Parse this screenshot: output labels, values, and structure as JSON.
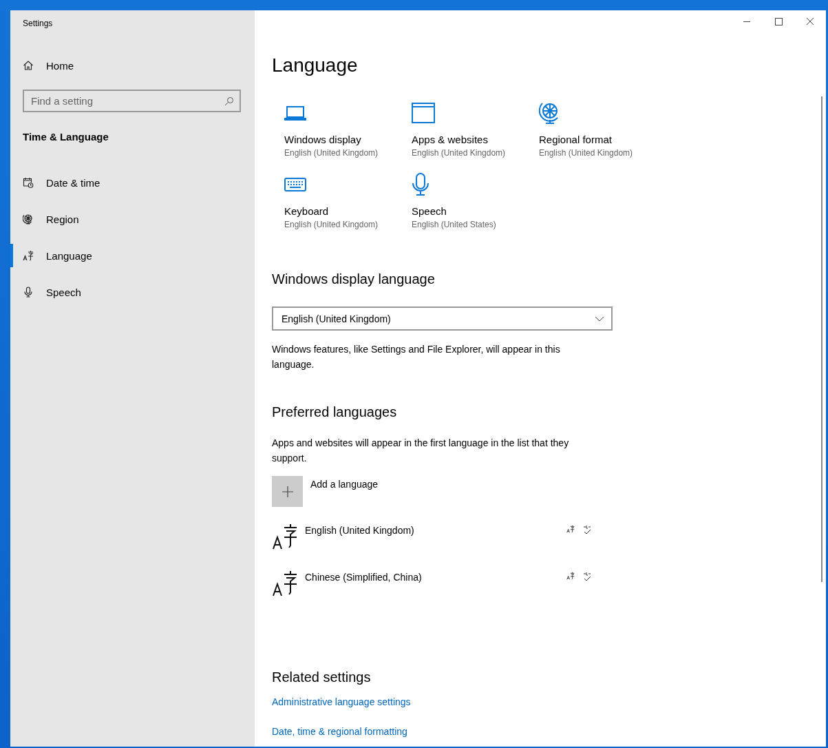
{
  "window": {
    "title": "Settings"
  },
  "sidebar": {
    "home": "Home",
    "search": {
      "placeholder": "Find a setting"
    },
    "section": "Time & Language",
    "items": [
      {
        "kind": "calendar",
        "label": "Date & time",
        "selected": false
      },
      {
        "kind": "globe",
        "label": "Region",
        "selected": false
      },
      {
        "kind": "language",
        "label": "Language",
        "selected": true
      },
      {
        "kind": "microphone",
        "label": "Speech",
        "selected": false
      }
    ]
  },
  "page": {
    "title": "Language",
    "tiles": [
      {
        "kind": "laptop",
        "title": "Windows display",
        "value": "English (United Kingdom)"
      },
      {
        "kind": "window",
        "title": "Apps & websites",
        "value": "English (United Kingdom)"
      },
      {
        "kind": "globe",
        "title": "Regional format",
        "value": "English (United Kingdom)"
      },
      {
        "kind": "keyboard",
        "title": "Keyboard",
        "value": "English (United Kingdom)"
      },
      {
        "kind": "microphone",
        "title": "Speech",
        "value": "English (United States)"
      }
    ],
    "display_language": {
      "heading": "Windows display language",
      "dropdown": "English (United Kingdom)",
      "note": "Windows features, like Settings and File Explorer, will appear in this language."
    },
    "preferred": {
      "heading": "Preferred languages",
      "note": "Apps and websites will appear in the first language in the list that they support.",
      "add": "Add a language",
      "languages": [
        {
          "name": "English (United Kingdom)"
        },
        {
          "name": "Chinese (Simplified, China)"
        }
      ]
    },
    "related": {
      "heading": "Related settings",
      "links": [
        "Administrative language settings",
        "Date, time & regional formatting"
      ]
    }
  }
}
